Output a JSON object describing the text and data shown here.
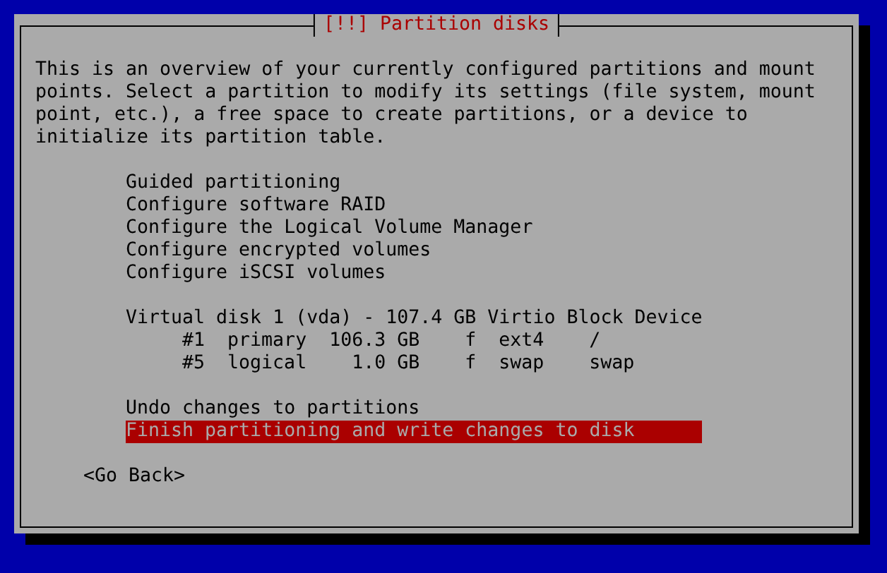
{
  "dialog": {
    "title": "[!!] Partition disks",
    "intro": "This is an overview of your currently configured partitions and mount points. Select a partition to modify its settings (file system, mount point, etc.), a free space to create partitions, or a device to initialize its partition table.",
    "sections": [
      {
        "items": [
          {
            "kind": "action",
            "label": "Guided partitioning",
            "selected": false
          },
          {
            "kind": "action",
            "label": "Configure software RAID",
            "selected": false
          },
          {
            "kind": "action",
            "label": "Configure the Logical Volume Manager",
            "selected": false
          },
          {
            "kind": "action",
            "label": "Configure encrypted volumes",
            "selected": false
          },
          {
            "kind": "action",
            "label": "Configure iSCSI volumes",
            "selected": false
          }
        ]
      },
      {
        "items": [
          {
            "kind": "disk",
            "label": "Virtual disk 1 (vda) - 107.4 GB Virtio Block Device",
            "selected": false
          },
          {
            "kind": "partition",
            "number": "#1",
            "type": "primary",
            "size": "106.3 GB",
            "flag": "f",
            "fs": "ext4",
            "mount": "/",
            "selected": false
          },
          {
            "kind": "partition",
            "number": "#5",
            "type": "logical",
            "size": "1.0 GB",
            "flag": "f",
            "fs": "swap",
            "mount": "swap",
            "selected": false
          }
        ]
      },
      {
        "items": [
          {
            "kind": "action",
            "label": "Undo changes to partitions",
            "selected": false
          },
          {
            "kind": "action",
            "label": "Finish partitioning and write changes to disk",
            "selected": true
          }
        ]
      }
    ],
    "back_button": "<Go Back>"
  }
}
